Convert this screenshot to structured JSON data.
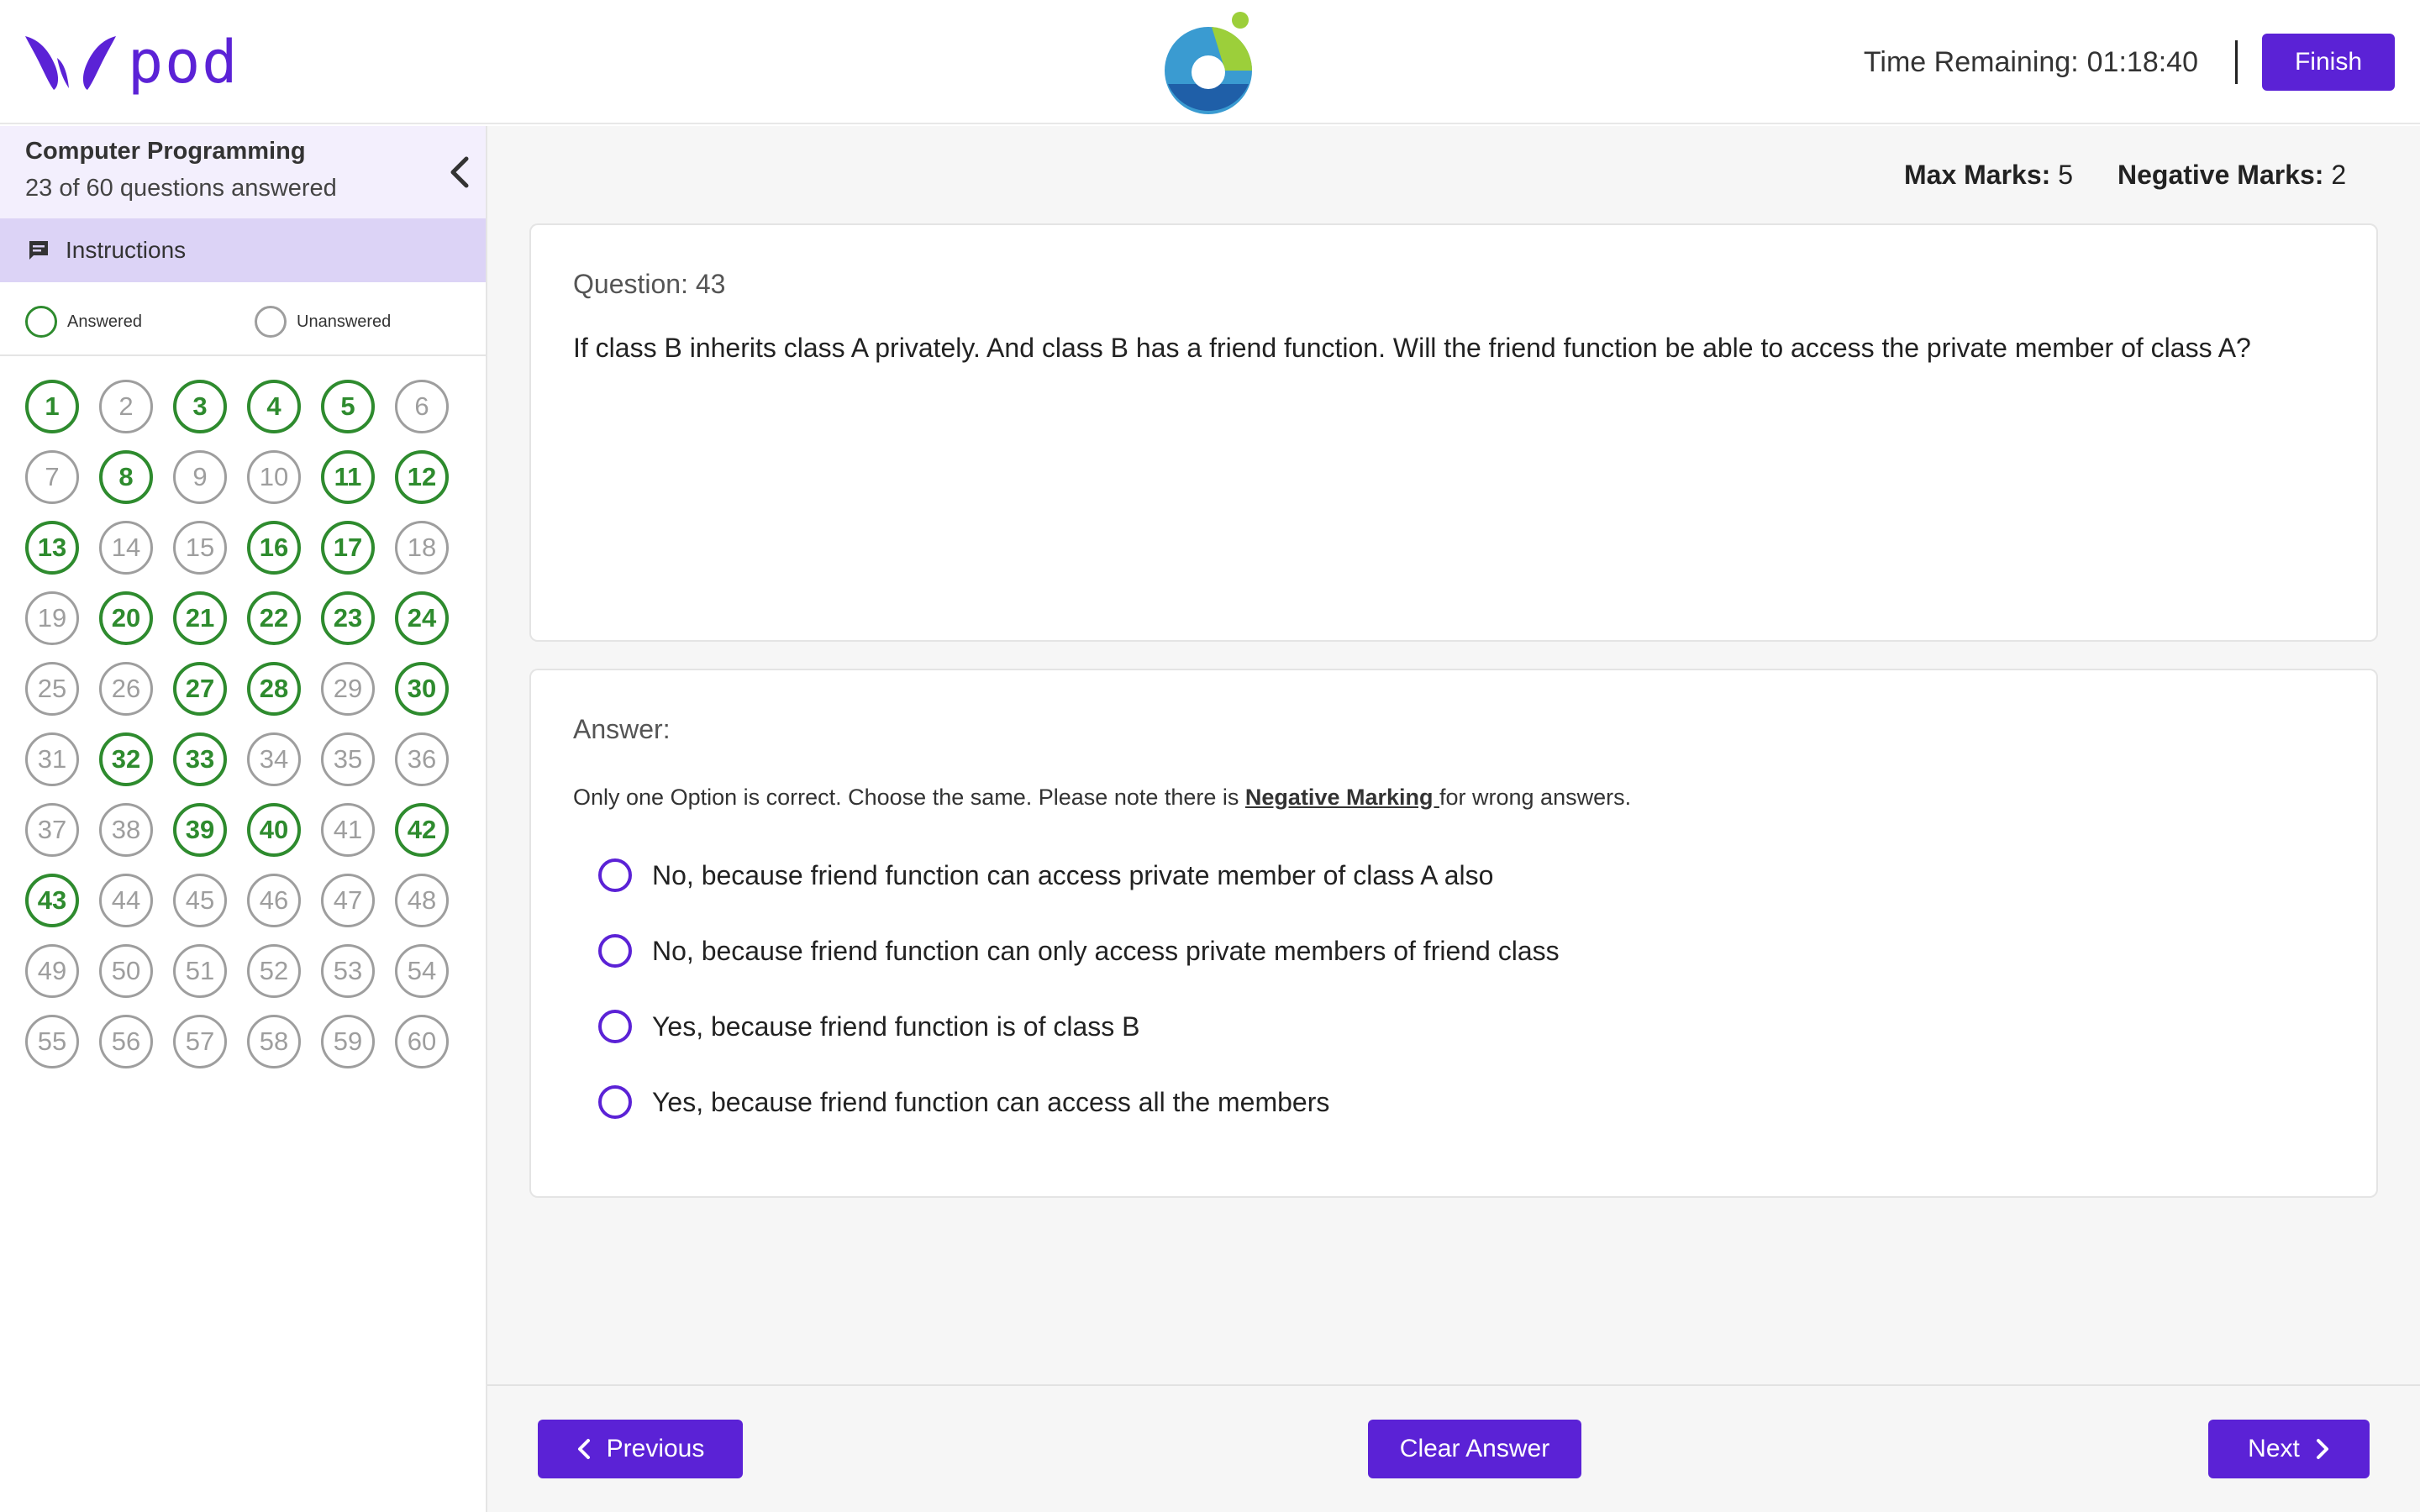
{
  "brand": {
    "logo_text": "pod",
    "accent_color": "#5b22d6",
    "answered_color": "#2e8b2e",
    "unanswered_color": "#9e9e9e"
  },
  "header": {
    "timer_label": "Time Remaining:",
    "timer_value": "01:18:40",
    "finish_label": "Finish"
  },
  "sidebar": {
    "subject": "Computer Programming",
    "progress": "23 of 60 questions answered",
    "instructions_label": "Instructions",
    "legend": {
      "answered": "Answered",
      "unanswered": "Unanswered"
    },
    "questions": [
      {
        "n": "1",
        "answered": true
      },
      {
        "n": "2",
        "answered": false
      },
      {
        "n": "3",
        "answered": true
      },
      {
        "n": "4",
        "answered": true
      },
      {
        "n": "5",
        "answered": true
      },
      {
        "n": "6",
        "answered": false
      },
      {
        "n": "7",
        "answered": false
      },
      {
        "n": "8",
        "answered": true
      },
      {
        "n": "9",
        "answered": false
      },
      {
        "n": "10",
        "answered": false
      },
      {
        "n": "11",
        "answered": true
      },
      {
        "n": "12",
        "answered": true
      },
      {
        "n": "13",
        "answered": true
      },
      {
        "n": "14",
        "answered": false
      },
      {
        "n": "15",
        "answered": false
      },
      {
        "n": "16",
        "answered": true
      },
      {
        "n": "17",
        "answered": true
      },
      {
        "n": "18",
        "answered": false
      },
      {
        "n": "19",
        "answered": false
      },
      {
        "n": "20",
        "answered": true
      },
      {
        "n": "21",
        "answered": true
      },
      {
        "n": "22",
        "answered": true
      },
      {
        "n": "23",
        "answered": true
      },
      {
        "n": "24",
        "answered": true
      },
      {
        "n": "25",
        "answered": false
      },
      {
        "n": "26",
        "answered": false
      },
      {
        "n": "27",
        "answered": true
      },
      {
        "n": "28",
        "answered": true
      },
      {
        "n": "29",
        "answered": false
      },
      {
        "n": "30",
        "answered": true
      },
      {
        "n": "31",
        "answered": false
      },
      {
        "n": "32",
        "answered": true
      },
      {
        "n": "33",
        "answered": true
      },
      {
        "n": "34",
        "answered": false
      },
      {
        "n": "35",
        "answered": false
      },
      {
        "n": "36",
        "answered": false
      },
      {
        "n": "37",
        "answered": false
      },
      {
        "n": "38",
        "answered": false
      },
      {
        "n": "39",
        "answered": true
      },
      {
        "n": "40",
        "answered": true
      },
      {
        "n": "41",
        "answered": false
      },
      {
        "n": "42",
        "answered": true
      },
      {
        "n": "43",
        "answered": true
      },
      {
        "n": "44",
        "answered": false
      },
      {
        "n": "45",
        "answered": false
      },
      {
        "n": "46",
        "answered": false
      },
      {
        "n": "47",
        "answered": false
      },
      {
        "n": "48",
        "answered": false
      },
      {
        "n": "49",
        "answered": false
      },
      {
        "n": "50",
        "answered": false
      },
      {
        "n": "51",
        "answered": false
      },
      {
        "n": "52",
        "answered": false
      },
      {
        "n": "53",
        "answered": false
      },
      {
        "n": "54",
        "answered": false
      },
      {
        "n": "55",
        "answered": false
      },
      {
        "n": "56",
        "answered": false
      },
      {
        "n": "57",
        "answered": false
      },
      {
        "n": "58",
        "answered": false
      },
      {
        "n": "59",
        "answered": false
      },
      {
        "n": "60",
        "answered": false
      }
    ]
  },
  "marks": {
    "max_label": "Max Marks:",
    "max_value": "5",
    "neg_label": "Negative Marks:",
    "neg_value": "2"
  },
  "question": {
    "number_label": "Question: 43",
    "text": "If class B inherits class A privately. And class B has a friend function. Will the friend function be able to access the private member of class A?"
  },
  "answer": {
    "heading": "Answer:",
    "note_prefix": "Only one Option is correct. Choose the same. Please note there is ",
    "note_emphasis": "Negative Marking ",
    "note_suffix": "for wrong answers.",
    "options": [
      "No, because friend function can access private member of class A also",
      "No, because friend function can only access private members of friend class",
      "Yes, because friend function is of class B",
      "Yes, because friend function can access all the members"
    ]
  },
  "footer": {
    "previous_label": "Previous",
    "clear_label": "Clear Answer",
    "next_label": "Next"
  }
}
